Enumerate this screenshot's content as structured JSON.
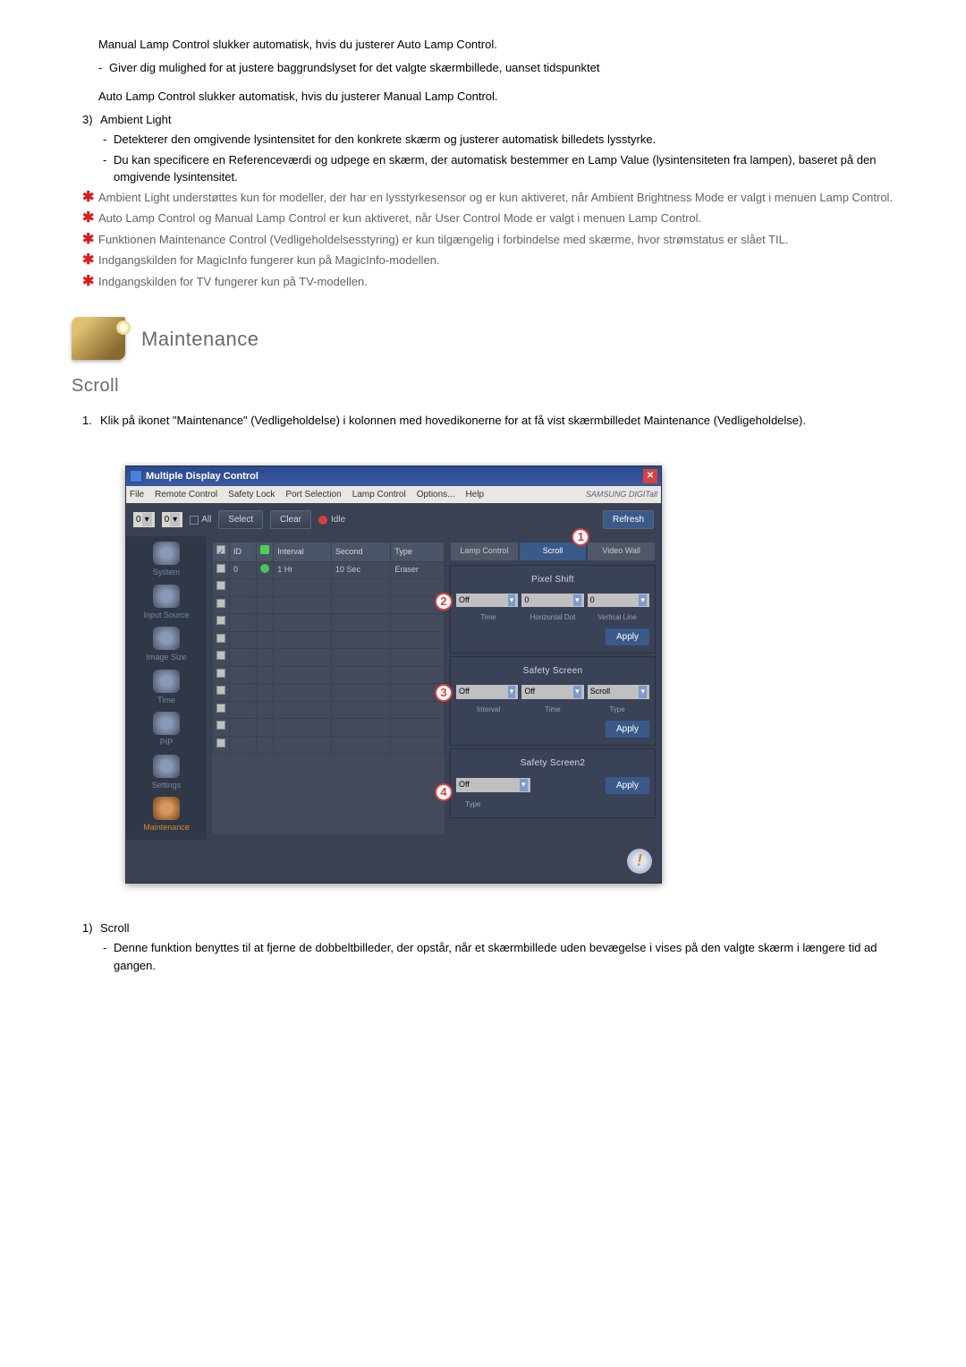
{
  "intro": {
    "manual_lamp": "Manual Lamp Control slukker automatisk, hvis du justerer Auto Lamp Control.",
    "dash1": "Giver dig mulighed for at justere baggrundslyset for det valgte skærmbillede, uanset tidspunktet",
    "auto_lamp": "Auto Lamp Control slukker automatisk, hvis du justerer Manual Lamp Control."
  },
  "item3": {
    "num": "3)",
    "title": "Ambient Light",
    "sub1": "Detekterer den omgivende lysintensitet for den konkrete skærm og justerer automatisk billedets lysstyrke.",
    "sub2": "Du kan specificere en Referenceværdi og udpege en skærm, der automatisk bestemmer en Lamp Value (lysintensiteten fra lampen), baseret på den omgivende lysintensitet."
  },
  "stars": {
    "s1": "Ambient Light understøttes kun for modeller, der har en lysstyrkesensor og er kun aktiveret, når Ambient Brightness Mode er valgt i menuen Lamp Control.",
    "s2": "Auto Lamp Control og Manual Lamp Control er kun aktiveret, når User Control Mode er valgt i menuen Lamp Control.",
    "s3": "Funktionen Maintenance Control (Vedligeholdelsesstyring) er kun tilgængelig i forbindelse med skærme, hvor strømstatus er slået TIL.",
    "s4": "Indgangskilden for MagicInfo fungerer kun på MagicInfo-modellen.",
    "s5": "Indgangskilden for TV fungerer kun på TV-modellen."
  },
  "section": {
    "title": "Maintenance",
    "subtitle": "Scroll"
  },
  "step1": {
    "num": "1.",
    "text": "Klik på ikonet \"Maintenance\" (Vedligeholdelse) i kolonnen med hovedikonerne for at få vist skærmbilledet Maintenance (Vedligeholdelse)."
  },
  "mdc": {
    "title": "Multiple Display Control",
    "menu": {
      "file": "File",
      "remote": "Remote Control",
      "safety": "Safety Lock",
      "port": "Port Selection",
      "lamp": "Lamp Control",
      "options": "Options...",
      "help": "Help"
    },
    "logo": "SAMSUNG DIGITall",
    "toolbar": {
      "spin1": "0",
      "spin2": "0",
      "all": "All",
      "select": "Select",
      "clear": "Clear",
      "idle": "Idle",
      "refresh": "Refresh"
    },
    "sidebar": {
      "system": "System",
      "input": "Input Source",
      "image": "Image Size",
      "time": "Time",
      "pip": "PIP",
      "settings": "Settings",
      "maintenance": "Maintenance"
    },
    "grid": {
      "headers": {
        "chk": "",
        "id": "ID",
        "st": "",
        "interval": "Interval",
        "second": "Second",
        "type": "Type"
      },
      "row": {
        "id": "0",
        "interval": "1 Hr",
        "second": "10 Sec",
        "type": "Eraser"
      }
    },
    "tabs": {
      "lamp": "Lamp Control",
      "scroll": "Scroll",
      "video": "Video Wall"
    },
    "pixel": {
      "header": "Pixel Shift",
      "off": "Off",
      "v1": "0",
      "v2": "0",
      "l_time": "Time",
      "l_hdot": "Horizontal Dot",
      "l_vline": "Vertical Line",
      "apply": "Apply"
    },
    "safety1": {
      "header": "Safety Screen",
      "off": "Off",
      "time": "Off",
      "type": "Scroll",
      "l_int": "Interval",
      "l_time": "Time",
      "l_type": "Type",
      "apply": "Apply"
    },
    "safety2": {
      "header": "Safety Screen2",
      "off": "Off",
      "l_type": "Type",
      "apply": "Apply"
    },
    "callouts": {
      "c1": "1",
      "c2": "2",
      "c3": "3",
      "c4": "4"
    }
  },
  "bottom": {
    "num": "1)",
    "label": "Scroll",
    "text": "Denne funktion benyttes til at fjerne de dobbeltbilleder, der opstår, når et skærmbillede uden bevægelse i vises på den valgte skærm i længere tid ad gangen."
  }
}
